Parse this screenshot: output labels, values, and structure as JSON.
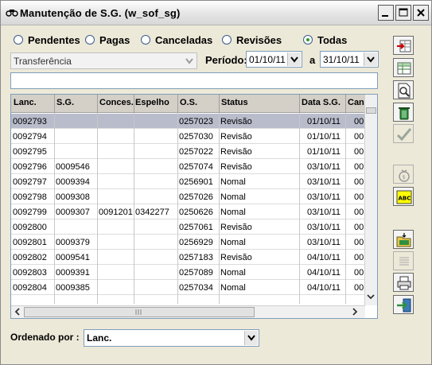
{
  "window": {
    "title": "Manutenção de S.G. (w_sof_sg)"
  },
  "filters": {
    "options": [
      {
        "label": "Pendentes",
        "selected": false
      },
      {
        "label": "Pagas",
        "selected": false
      },
      {
        "label": "Canceladas",
        "selected": false
      },
      {
        "label": "Revisões",
        "selected": false
      },
      {
        "label": "Todas",
        "selected": true
      }
    ],
    "type_value": "Transferência",
    "period_label": "Período:",
    "date_from": "01/10/11",
    "between_label": "a",
    "date_to": "31/10/11"
  },
  "grid": {
    "columns": [
      "Lanc.",
      "S.G.",
      "Conces.",
      "Espelho",
      "O.S.",
      "Status",
      "Data S.G.",
      "Can"
    ],
    "rows": [
      {
        "lanc": "0092793",
        "sg": "",
        "conces": "",
        "espelho": "",
        "os": "0257023",
        "status": "Revisão",
        "data": "01/10/11",
        "can": "00",
        "selected": true
      },
      {
        "lanc": "0092794",
        "sg": "",
        "conces": "",
        "espelho": "",
        "os": "0257030",
        "status": "Revisão",
        "data": "01/10/11",
        "can": "00"
      },
      {
        "lanc": "0092795",
        "sg": "",
        "conces": "",
        "espelho": "",
        "os": "0257022",
        "status": "Revisão",
        "data": "01/10/11",
        "can": "00"
      },
      {
        "lanc": "0092796",
        "sg": "0009546",
        "conces": "",
        "espelho": "",
        "os": "0257074",
        "status": "Revisão",
        "data": "03/10/11",
        "can": "00"
      },
      {
        "lanc": "0092797",
        "sg": "0009394",
        "conces": "",
        "espelho": "",
        "os": "0256901",
        "status": "Nomal",
        "data": "03/10/11",
        "can": "00"
      },
      {
        "lanc": "0092798",
        "sg": "0009308",
        "conces": "",
        "espelho": "",
        "os": "0257026",
        "status": "Nomal",
        "data": "03/10/11",
        "can": "00"
      },
      {
        "lanc": "0092799",
        "sg": "0009307",
        "conces": "0091201",
        "espelho": "0342277",
        "os": "0250626",
        "status": "Nomal",
        "data": "03/10/11",
        "can": "00"
      },
      {
        "lanc": "0092800",
        "sg": "",
        "conces": "",
        "espelho": "",
        "os": "0257061",
        "status": "Revisão",
        "data": "03/10/11",
        "can": "00"
      },
      {
        "lanc": "0092801",
        "sg": "0009379",
        "conces": "",
        "espelho": "",
        "os": "0256929",
        "status": "Nomal",
        "data": "03/10/11",
        "can": "00"
      },
      {
        "lanc": "0092802",
        "sg": "0009541",
        "conces": "",
        "espelho": "",
        "os": "0257183",
        "status": "Revisão",
        "data": "04/10/11",
        "can": "00"
      },
      {
        "lanc": "0092803",
        "sg": "0009391",
        "conces": "",
        "espelho": "",
        "os": "0257089",
        "status": "Nomal",
        "data": "04/10/11",
        "can": "00"
      },
      {
        "lanc": "0092804",
        "sg": "0009385",
        "conces": "",
        "espelho": "",
        "os": "0257034",
        "status": "Nomal",
        "data": "04/10/11",
        "can": "00"
      }
    ]
  },
  "sort": {
    "label": "Ordenado por :",
    "value": "Lanc."
  },
  "toolbar": {
    "buttons": [
      {
        "name": "insert-row-icon",
        "enabled": true
      },
      {
        "name": "edit-grid-icon",
        "enabled": true
      },
      {
        "name": "preview-icon",
        "enabled": true
      },
      {
        "name": "delete-icon",
        "enabled": true
      },
      {
        "name": "confirm-icon",
        "enabled": false
      },
      {
        "name": "money-bag-icon",
        "enabled": false
      },
      {
        "name": "spellcheck-icon",
        "label": "ABC",
        "enabled": true
      },
      {
        "name": "open-folder-icon",
        "enabled": true
      },
      {
        "name": "list-icon",
        "enabled": false
      },
      {
        "name": "print-icon",
        "enabled": true
      },
      {
        "name": "exit-icon",
        "enabled": true
      }
    ]
  }
}
